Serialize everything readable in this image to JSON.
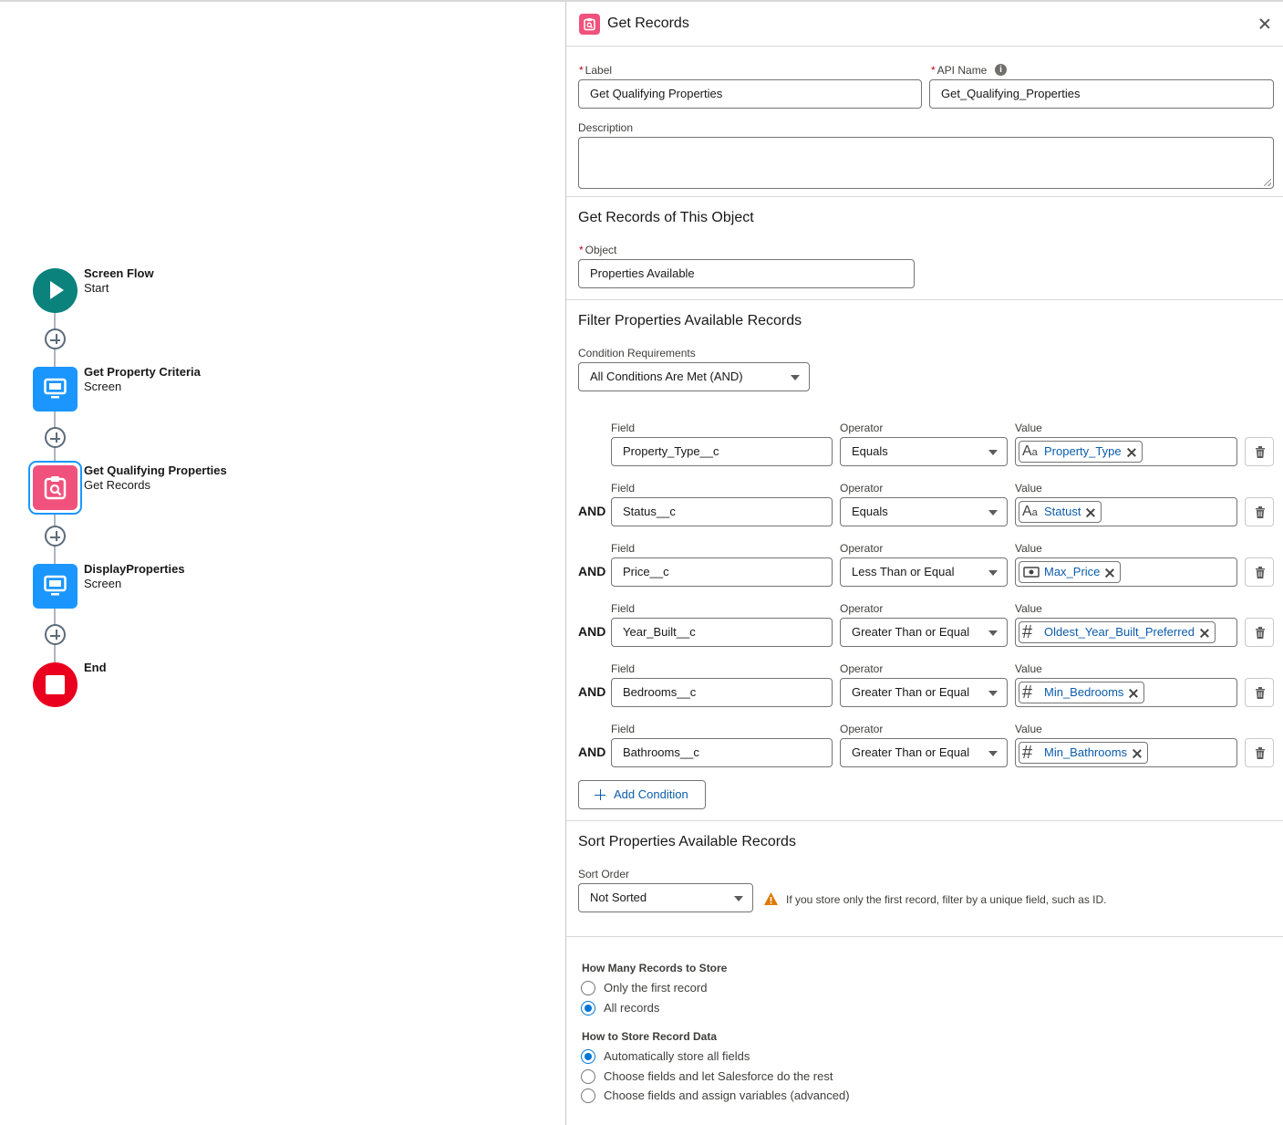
{
  "canvas": {
    "nodes": [
      {
        "title": "Screen Flow",
        "subtitle": "Start"
      },
      {
        "title": "Get Property Criteria",
        "subtitle": "Screen"
      },
      {
        "title": "Get Qualifying Properties",
        "subtitle": "Get Records"
      },
      {
        "title": "DisplayProperties",
        "subtitle": "Screen"
      },
      {
        "title": "End",
        "subtitle": ""
      }
    ]
  },
  "panel": {
    "title": "Get Records",
    "label_field": {
      "label": "Label",
      "value": "Get Qualifying Properties"
    },
    "api_name_field": {
      "label": "API Name",
      "value": "Get_Qualifying_Properties"
    },
    "description_field": {
      "label": "Description",
      "value": ""
    },
    "object_section": {
      "title": "Get Records of This Object",
      "object_label": "Object",
      "object_value": "Properties Available"
    },
    "filter_section": {
      "title": "Filter Properties Available Records",
      "condition_requirements_label": "Condition Requirements",
      "condition_requirements_value": "All Conditions Are Met (AND)",
      "field_label": "Field",
      "operator_label": "Operator",
      "value_label": "Value",
      "and_label": "AND",
      "conditions": [
        {
          "field": "Property_Type__c",
          "operator": "Equals",
          "value": "Property_Type",
          "value_icon": "text-icon"
        },
        {
          "field": "Status__c",
          "operator": "Equals",
          "value": "Statust",
          "value_icon": "text-icon"
        },
        {
          "field": "Price__c",
          "operator": "Less Than or Equal",
          "value": "Max_Price",
          "value_icon": "currency-icon"
        },
        {
          "field": "Year_Built__c",
          "operator": "Greater Than or Equal",
          "value": "Oldest_Year_Built_Preferred",
          "value_icon": "number-icon"
        },
        {
          "field": "Bedrooms__c",
          "operator": "Greater Than or Equal",
          "value": "Min_Bedrooms",
          "value_icon": "number-icon"
        },
        {
          "field": "Bathrooms__c",
          "operator": "Greater Than or Equal",
          "value": "Min_Bathrooms",
          "value_icon": "number-icon"
        }
      ],
      "add_condition_label": "Add Condition"
    },
    "sort_section": {
      "title": "Sort Properties Available Records",
      "sort_order_label": "Sort Order",
      "sort_order_value": "Not Sorted",
      "warning": "If you store only the first record, filter by a unique field, such as ID."
    },
    "store_section": {
      "how_many_title": "How Many Records to Store",
      "how_many_options": [
        "Only the first record",
        "All records"
      ],
      "how_many_selected": 1,
      "how_store_title": "How to Store Record Data",
      "how_store_options": [
        "Automatically store all fields",
        "Choose fields and let Salesforce do the rest",
        "Choose fields and assign variables (advanced)"
      ],
      "how_store_selected": 0
    }
  },
  "colors": {
    "start": "#0b827c",
    "screen": "#1b96ff",
    "get_records": "#f0527d",
    "end": "#ea001e",
    "link": "#0b5cab",
    "radio": "#0176d3"
  }
}
